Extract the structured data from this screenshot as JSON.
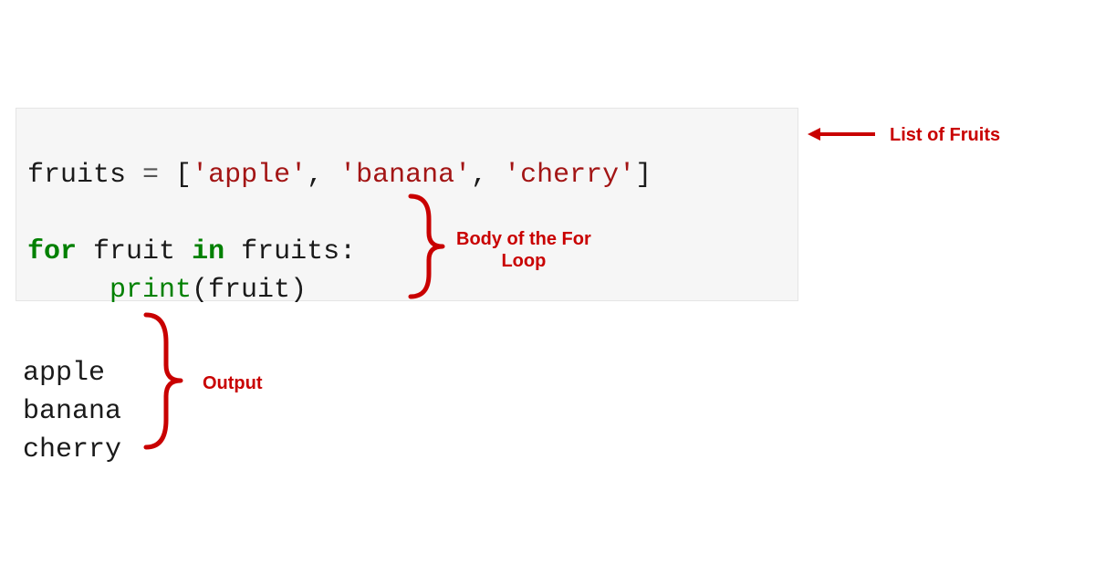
{
  "code": {
    "line1": {
      "var": "fruits",
      "eq": " = ",
      "lb": "[",
      "s1": "'apple'",
      "c1": ", ",
      "s2": "'banana'",
      "c2": ", ",
      "s3": "'cherry'",
      "rb": "]"
    },
    "line3": {
      "for": "for",
      "sp1": " ",
      "iter": "fruit",
      "sp2": " ",
      "in": "in",
      "sp3": " ",
      "seq": "fruits",
      "colon": ":"
    },
    "line4": {
      "indent": "     ",
      "func": "print",
      "open": "(",
      "arg": "fruit",
      "close": ")"
    }
  },
  "output": {
    "l1": "apple",
    "l2": "banana",
    "l3": "cherry"
  },
  "annotations": {
    "list_label": "List of Fruits",
    "body_label_l1": "Body of the For",
    "body_label_l2": "Loop",
    "output_label": "Output"
  }
}
